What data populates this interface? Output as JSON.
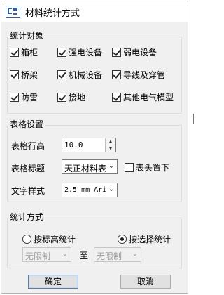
{
  "window": {
    "title": "材料统计方式"
  },
  "objects_group": {
    "label": "统计对象",
    "items": [
      {
        "label": "箱柜",
        "checked": true
      },
      {
        "label": "强电设备",
        "checked": true
      },
      {
        "label": "弱电设备",
        "checked": true
      },
      {
        "label": "桥架",
        "checked": true
      },
      {
        "label": "机械设备",
        "checked": true
      },
      {
        "label": "导线及穿管",
        "checked": true
      },
      {
        "label": "防雷",
        "checked": true
      },
      {
        "label": "接地",
        "checked": true
      },
      {
        "label": "其他电气模型",
        "checked": true
      }
    ]
  },
  "table_group": {
    "label": "表格设置",
    "row_height_label": "表格行高",
    "row_height_value": "10.0",
    "title_label": "表格标题",
    "title_value": "天正材料表",
    "header_below_label": "表头置下",
    "header_below_checked": false,
    "text_style_label": "文字样式",
    "text_style_value": "2.5 mm Ari"
  },
  "method_group": {
    "label": "统计方式",
    "by_elevation_label": "按标高统计",
    "by_selection_label": "按选择统计",
    "selected": "by_selection",
    "from_value": "无限制",
    "to_label": "至",
    "to_value": "无限制"
  },
  "buttons": {
    "ok": "确定",
    "cancel": "取消"
  }
}
